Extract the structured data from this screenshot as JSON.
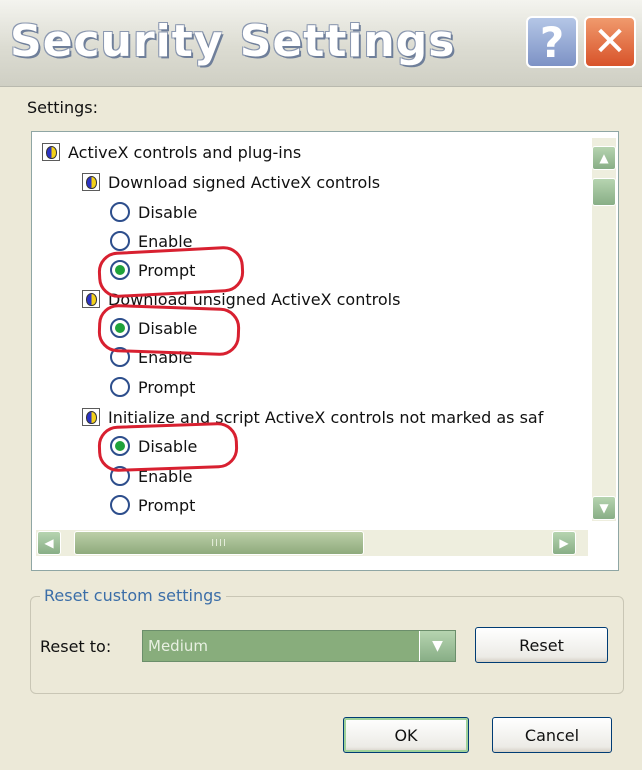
{
  "window": {
    "title": "Security Settings",
    "help_label": "?",
    "close_label": "✕"
  },
  "settings_label": "Settings:",
  "tree": {
    "group_label": "ActiveX controls and plug-ins",
    "items": [
      {
        "label": "Download signed ActiveX controls",
        "options": [
          {
            "label": "Disable",
            "checked": false
          },
          {
            "label": "Enable",
            "checked": false
          },
          {
            "label": "Prompt",
            "checked": true
          }
        ]
      },
      {
        "label": "Download unsigned ActiveX controls",
        "options": [
          {
            "label": "Disable",
            "checked": true
          },
          {
            "label": "Enable",
            "checked": false
          },
          {
            "label": "Prompt",
            "checked": false
          }
        ]
      },
      {
        "label": "Initialize and script ActiveX controls not marked as saf",
        "options": [
          {
            "label": "Disable",
            "checked": true
          },
          {
            "label": "Enable",
            "checked": false
          },
          {
            "label": "Prompt",
            "checked": false
          }
        ]
      }
    ]
  },
  "scrollbar": {
    "up_icon": "▲",
    "down_icon": "▼",
    "left_icon": "◀",
    "right_icon": "▶",
    "thumb_grip": "IIII"
  },
  "reset": {
    "legend": "Reset custom settings",
    "label": "Reset to:",
    "value": "Medium",
    "dropdown_icon": "▼",
    "button": "Reset"
  },
  "footer": {
    "ok": "OK",
    "cancel": "Cancel"
  },
  "colors": {
    "annotation": "#d82030",
    "radio_selected": "#1fa23a",
    "accent": "#3b6ea8"
  }
}
